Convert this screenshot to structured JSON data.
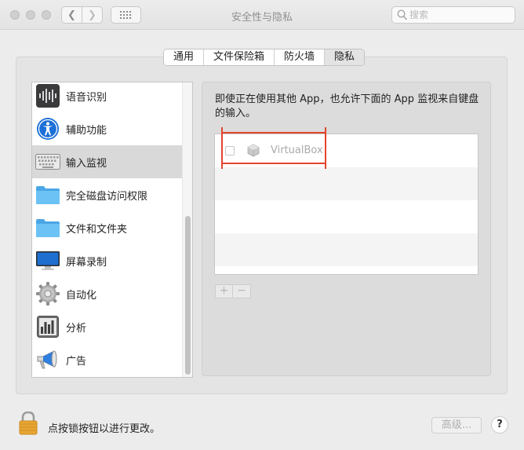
{
  "window": {
    "title": "安全性与隐私",
    "search_placeholder": "搜索"
  },
  "tabs": [
    {
      "label": "通用",
      "active": false
    },
    {
      "label": "文件保险箱",
      "active": false
    },
    {
      "label": "防火墙",
      "active": false
    },
    {
      "label": "隐私",
      "active": true
    }
  ],
  "sidebar": {
    "items": [
      {
        "label": "语音识别",
        "icon": "waveform-icon",
        "selected": false
      },
      {
        "label": "辅助功能",
        "icon": "accessibility-icon",
        "selected": false
      },
      {
        "label": "输入监视",
        "icon": "keyboard-icon",
        "selected": true
      },
      {
        "label": "完全磁盘访问权限",
        "icon": "folder-icon",
        "selected": false
      },
      {
        "label": "文件和文件夹",
        "icon": "folder-icon",
        "selected": false
      },
      {
        "label": "屏幕录制",
        "icon": "monitor-icon",
        "selected": false
      },
      {
        "label": "自动化",
        "icon": "gear-icon",
        "selected": false
      },
      {
        "label": "分析",
        "icon": "bar-chart-icon",
        "selected": false
      },
      {
        "label": "广告",
        "icon": "megaphone-icon",
        "selected": false
      }
    ]
  },
  "panel": {
    "description": "即使正在使用其他 App，也允许下面的 App 监视来自键盘的输入。",
    "apps": [
      {
        "name": "VirtualBox",
        "checked": false,
        "icon": "cube-icon"
      }
    ],
    "add_symbol": "+",
    "remove_symbol": "−"
  },
  "footer": {
    "lock_text": "点按锁按钮以进行更改。",
    "advanced_label": "高级...",
    "help_label": "?"
  },
  "colors": {
    "highlight": "#e3442c",
    "folder": "#5ab4ef",
    "accessibility": "#1b6fd8",
    "lock": "#e8a534"
  }
}
